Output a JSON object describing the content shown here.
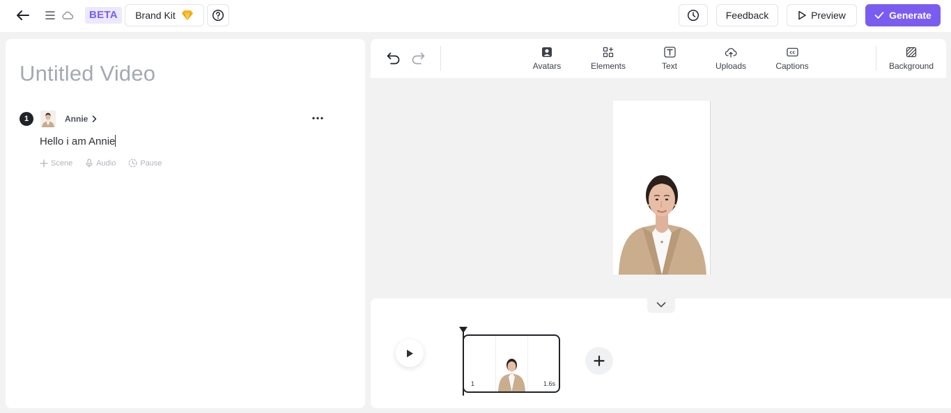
{
  "topbar": {
    "beta_label": "BETA",
    "brand_kit_label": "Brand Kit",
    "feedback_label": "Feedback",
    "preview_label": "Preview",
    "generate_label": "Generate",
    "accent_color": "#7b5cf0"
  },
  "script": {
    "title_placeholder": "Untitled Video",
    "scenes": [
      {
        "number": "1",
        "avatar_name": "Annie",
        "text": "Hello i am Annie"
      }
    ],
    "actions": [
      {
        "label": "Scene",
        "icon": "plus-icon"
      },
      {
        "label": "Audio",
        "icon": "microphone-icon"
      },
      {
        "label": "Pause",
        "icon": "pause-icon"
      }
    ]
  },
  "toolbar": {
    "tools": [
      {
        "label": "Avatars",
        "icon": "avatar-icon"
      },
      {
        "label": "Elements",
        "icon": "elements-icon"
      },
      {
        "label": "Text",
        "icon": "text-icon"
      },
      {
        "label": "Uploads",
        "icon": "upload-icon"
      },
      {
        "label": "Captions",
        "icon": "captions-icon"
      },
      {
        "label": "Background",
        "icon": "background-icon"
      }
    ]
  },
  "timeline": {
    "clips": [
      {
        "index": "1",
        "duration": "1.6s"
      }
    ]
  }
}
